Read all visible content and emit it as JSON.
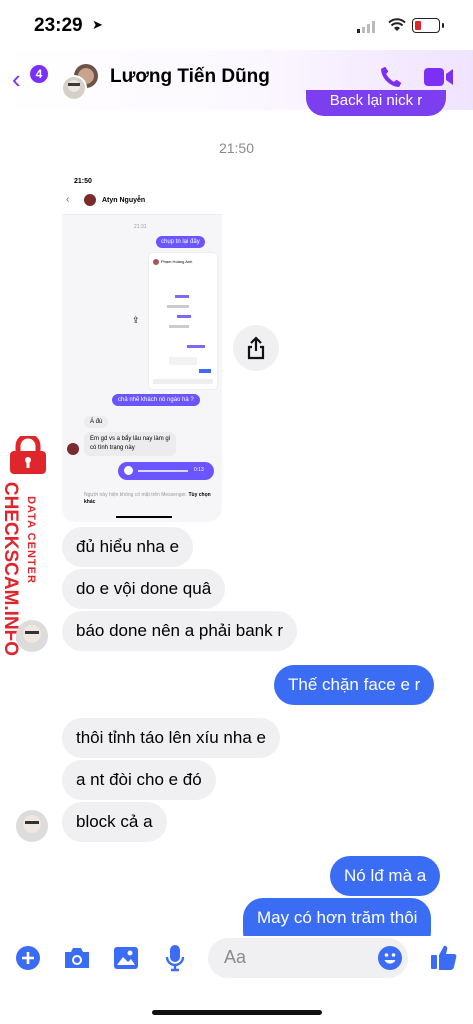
{
  "status_bar": {
    "time": "23:29"
  },
  "header": {
    "back_count": "4",
    "contact_name": "Lương Tiến Dũng"
  },
  "top_bubble": "Back lại nick r",
  "timestamp": "21:50",
  "screenshot": {
    "time": "21:50",
    "contact": "Atyn Nguyễn",
    "time2": "21:31",
    "bubble1": "chụp tn lại đây",
    "inner_contact": "Phạm Hoàng Anh",
    "bubble2": "chả nhẽ khách nó ngáo hả ?",
    "bubble3": "Á đù",
    "bubble4a": "Em gd vs a bẩy lâu nay làm gì",
    "bubble4b": "có tình trạng này",
    "voice_time": "0:13",
    "footer": "Người này hiện không có mặt trên Messenger.",
    "footer_link": "Tùy chọn khác"
  },
  "messages": [
    {
      "text": "đủ hiểu nha e",
      "dir": "in"
    },
    {
      "text": "do e vội done quâ",
      "dir": "in"
    },
    {
      "text": "báo done nên a phải bank r",
      "dir": "in"
    },
    {
      "text": "Thế chặn face e r",
      "dir": "out"
    },
    {
      "text": "thôi tỉnh táo lên xíu nha e",
      "dir": "in"
    },
    {
      "text": "a nt đòi cho e đó",
      "dir": "in"
    },
    {
      "text": "block cả a",
      "dir": "in"
    },
    {
      "text": "Nó lđ mà a",
      "dir": "out"
    },
    {
      "text": "May có hơn trăm thôi",
      "dir": "out"
    }
  ],
  "watermark": {
    "line1": "DATA CENTER",
    "line2": "CHECKSCAM.INFO"
  },
  "composer": {
    "placeholder": "Aa"
  },
  "colors": {
    "accent": "#7b2ff7",
    "outgoing": "#3a6cf4",
    "incoming": "#f0f0f2",
    "watermark": "#e0262d"
  }
}
